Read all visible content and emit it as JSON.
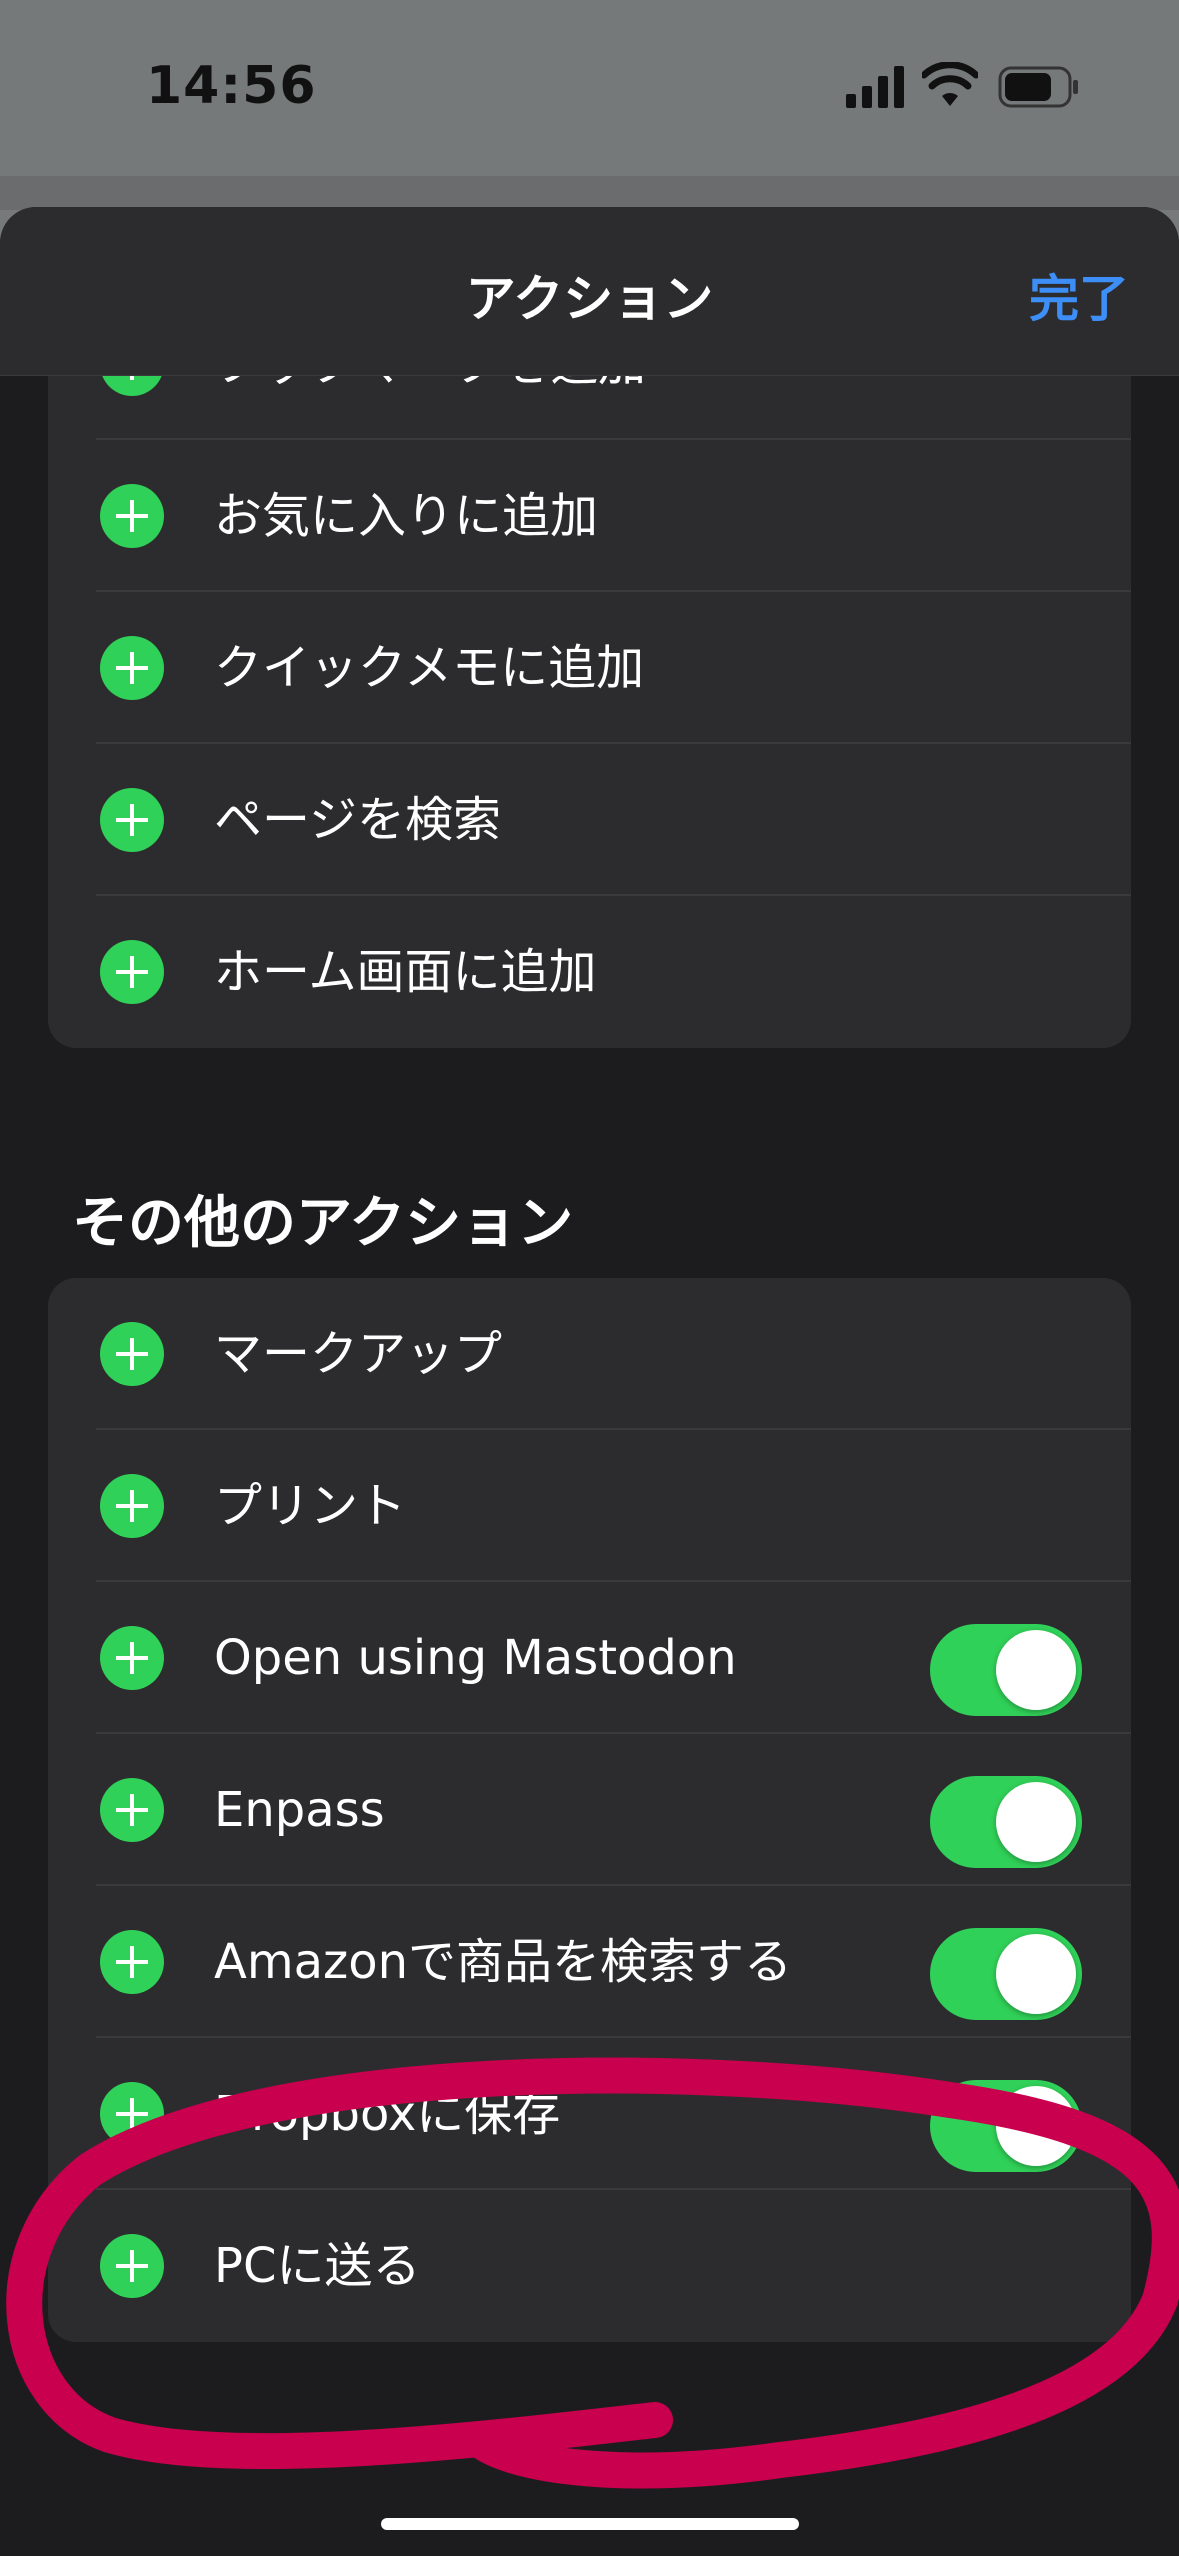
{
  "status_bar": {
    "time": "14:56"
  },
  "header": {
    "title": "アクション",
    "done_label": "完了"
  },
  "group1": {
    "items": [
      {
        "label": "ブックマークを追加"
      },
      {
        "label": "お気に入りに追加"
      },
      {
        "label": "クイックメモに追加"
      },
      {
        "label": "ページを検索"
      },
      {
        "label": "ホーム画面に追加"
      }
    ]
  },
  "other_actions": {
    "title": "その他のアクション",
    "items": [
      {
        "label": "マークアップ",
        "toggle": null
      },
      {
        "label": "プリント",
        "toggle": null
      },
      {
        "label": "Open using Mastodon",
        "toggle": true
      },
      {
        "label": "Enpass",
        "toggle": true
      },
      {
        "label": "Amazonで商品を検索する",
        "toggle": true
      },
      {
        "label": "Dropboxに保存",
        "toggle": true
      },
      {
        "label": "PCに送る",
        "toggle": null
      }
    ]
  },
  "colors": {
    "accent": "#3d8ef6",
    "add_icon": "#30d158",
    "toggle_on": "#30d158",
    "annotation": "#c8004e"
  }
}
